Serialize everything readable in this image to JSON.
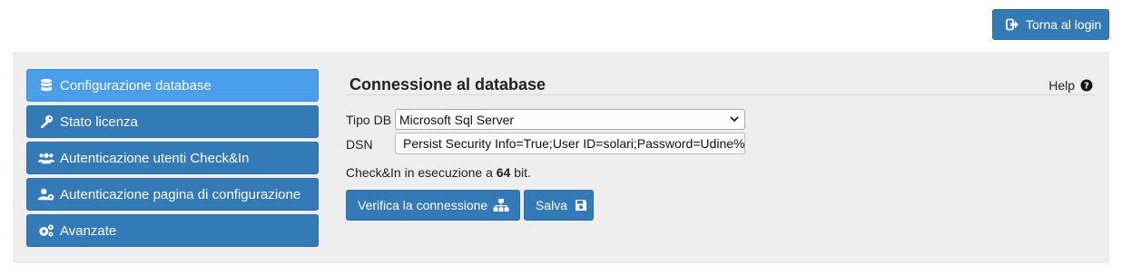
{
  "header": {
    "logout_label": "Torna al login"
  },
  "sidebar": {
    "items": [
      {
        "label": "Configurazione database",
        "icon": "database-icon",
        "active": true
      },
      {
        "label": "Stato licenza",
        "icon": "key-icon",
        "active": false
      },
      {
        "label": "Autenticazione utenti Check&In",
        "icon": "users-icon",
        "active": false
      },
      {
        "label": "Autenticazione pagina di configurazione",
        "icon": "user-cog-icon",
        "active": false
      },
      {
        "label": "Avanzate",
        "icon": "cogs-icon",
        "active": false
      }
    ]
  },
  "main": {
    "title": "Connessione al database",
    "help_label": "Help",
    "form": {
      "tipo_label": "Tipo DB",
      "tipo_value": "Microsoft Sql Server",
      "dsn_label": "DSN",
      "dsn_value": "Persist Security Info=True;User ID=solari;Password=Udine%"
    },
    "runtime": {
      "prefix": "Check&In in esecuzione a ",
      "bits": "64",
      "suffix": " bit."
    },
    "buttons": {
      "verify_label": "Verifica la connessione",
      "save_label": "Salva"
    }
  },
  "colors": {
    "primary": "#337ab7",
    "active": "#4a9eea",
    "panel_bg": "#eeeeee"
  }
}
